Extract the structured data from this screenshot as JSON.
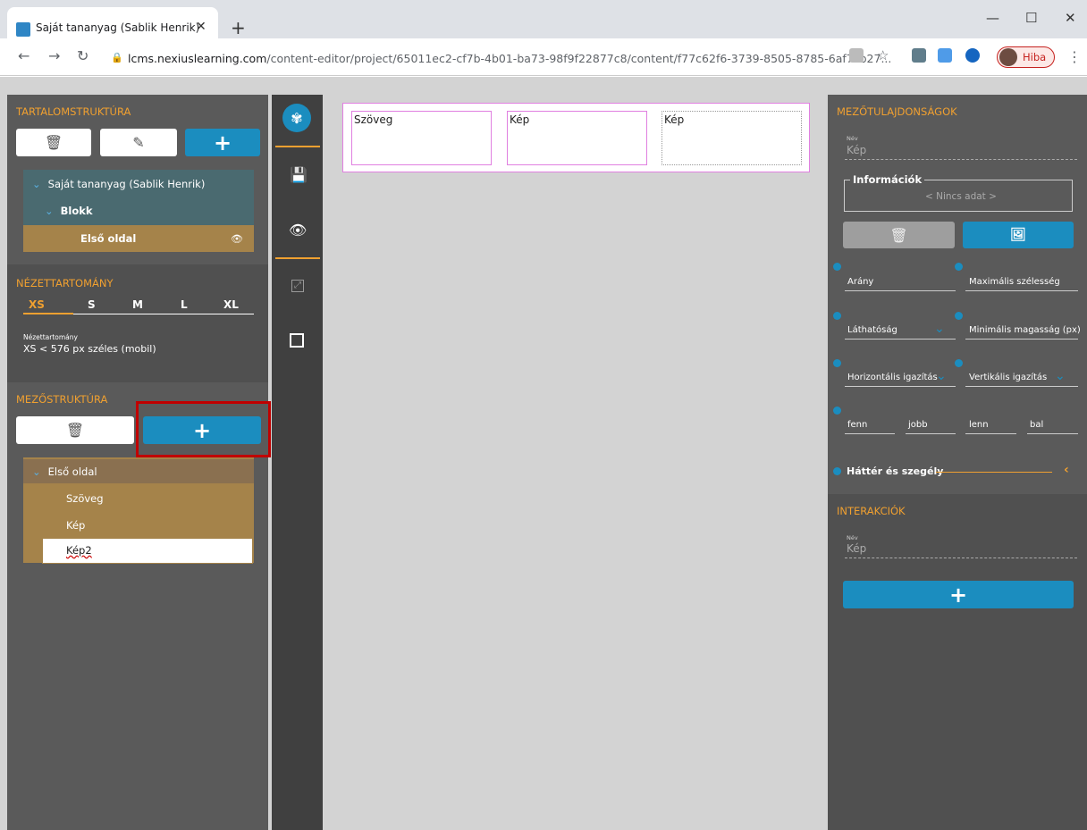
{
  "browser": {
    "tab_title": "Saját tananyag (Sablik Henrik)",
    "url_host": "lcms.nexiuslearning.com",
    "url_path": "/content-editor/project/65011ec2-cf7b-4b01-ba73-98f9f22877c8/content/f77c62f6-3739-8505-8785-6af7cb27...",
    "profile_label": "Hiba"
  },
  "left": {
    "content_structure_title": "TARTALOMSTRUKTÚRA",
    "tree": [
      "Saját tananyag (Sablik Henrik)",
      "Blokk",
      "Első oldal"
    ],
    "viewport_title": "NÉZETTARTOMÁNY",
    "viewport_tabs": [
      "XS",
      "S",
      "M",
      "L",
      "XL"
    ],
    "viewport_label": "Nézettartomány",
    "viewport_desc": "XS < 576 px széles (mobil)",
    "field_structure_title": "MEZŐSTRUKTÚRA",
    "fields": [
      "Első oldal",
      "Szöveg",
      "Kép",
      "Kép2"
    ]
  },
  "stage": {
    "cells": [
      "Szöveg",
      "Kép",
      "Kép"
    ]
  },
  "right": {
    "props_title": "MEZŐTULAJDONSÁGOK",
    "name_label": "Név",
    "name_value": "Kép",
    "info_legend": "Információk",
    "info_value": "< Nincs adat >",
    "props": {
      "arany": "Arány",
      "max_width": "Maximális szélesség",
      "visibility": "Láthatóság",
      "min_height": "Minimális magasság (px)",
      "h_align": "Horizontális igazítás",
      "v_align": "Vertikális igazítás",
      "top": "fenn",
      "right": "jobb",
      "bottom": "lenn",
      "left": "bal"
    },
    "background_border": "Háttér és szegély",
    "interactions_title": "INTERAKCIÓK",
    "int_name_label": "Név",
    "int_name_value": "Kép"
  },
  "colors": {
    "accent": "#f0a030",
    "primary": "#1b8dbf",
    "tree_bg": "#4a6a70",
    "field_bg": "#a5834a",
    "highlight": "#c00000"
  }
}
